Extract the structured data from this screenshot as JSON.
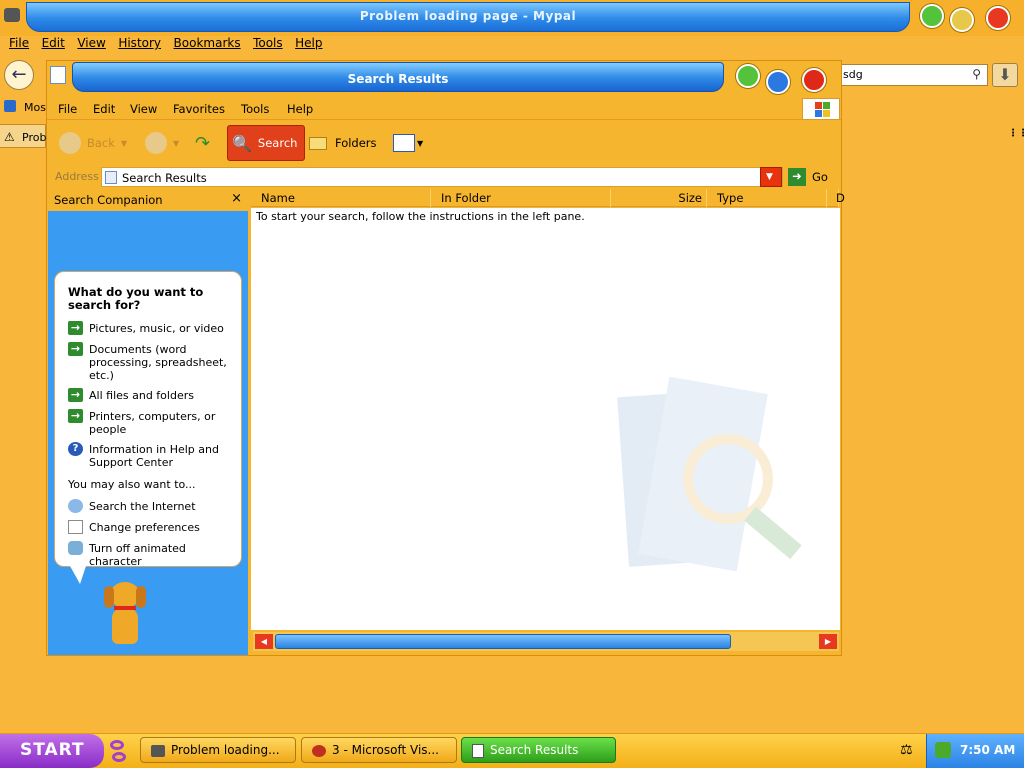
{
  "browser": {
    "title": "Problem loading page - Mypal",
    "menu": [
      "File",
      "Edit",
      "View",
      "History",
      "Bookmarks",
      "Tools",
      "Help"
    ],
    "url_fragment": "sdg",
    "bookmark_fragment": "Mos",
    "tab_fragment": "Prob"
  },
  "window": {
    "title": "Search Results",
    "menu": [
      "File",
      "Edit",
      "View",
      "Favorites",
      "Tools",
      "Help"
    ],
    "toolbar": {
      "back": "Back",
      "search": "Search",
      "folders": "Folders"
    },
    "address_label": "Address",
    "address_value": "Search Results",
    "go_label": "Go"
  },
  "companion": {
    "header": "Search Companion",
    "question": "What do you want to search for?",
    "options": [
      "Pictures, music, or video",
      "Documents (word processing, spreadsheet, etc.)",
      "All files and folders",
      "Printers, computers, or people",
      "Information in Help and Support Center"
    ],
    "also_label": "You may also want to...",
    "also": [
      "Search the Internet",
      "Change preferences",
      "Turn off animated character"
    ]
  },
  "results": {
    "columns": [
      "Name",
      "In Folder",
      "Size",
      "Type",
      "D"
    ],
    "hint": "To start your search, follow the instructions in the left pane."
  },
  "taskbar": {
    "start": "START",
    "tasks": [
      "Problem loading...",
      "3 - Microsoft Vis...",
      "Search Results"
    ],
    "clock": "7:50 AM"
  },
  "colors": {
    "accent": "#f5b52e",
    "title_blue": "#2d88e6",
    "pane_blue": "#3a9bf2",
    "search_red": "#e0401a"
  }
}
